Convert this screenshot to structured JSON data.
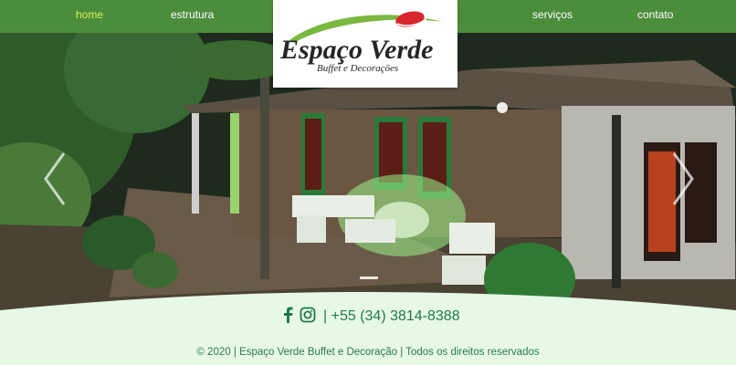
{
  "nav": {
    "items": [
      {
        "label": "home",
        "active": true
      },
      {
        "label": "estrutura",
        "active": false
      },
      {
        "label": "serviços",
        "active": false
      },
      {
        "label": "contato",
        "active": false
      }
    ]
  },
  "logo": {
    "title": "Espaço Verde",
    "subtitle": "Buffet e Decorações"
  },
  "hero": {
    "prev_icon": "chevron-left-icon",
    "next_icon": "chevron-right-icon",
    "slide_indicator": "active-slide"
  },
  "footer": {
    "facebook_icon": "facebook-icon",
    "instagram_icon": "instagram-icon",
    "phone": "| +55 (34) 3814-8388",
    "copyright": "© 2020 | Espaço Verde Buffet e Decoração | Todos os direitos reservados"
  },
  "colors": {
    "nav_bg": "#4c8d3c",
    "nav_active": "#d7f25a",
    "footer_bg": "#e8f8e6",
    "footer_text": "#1f7a4a",
    "logo_red": "#d8262f",
    "logo_green": "#7ab840"
  }
}
